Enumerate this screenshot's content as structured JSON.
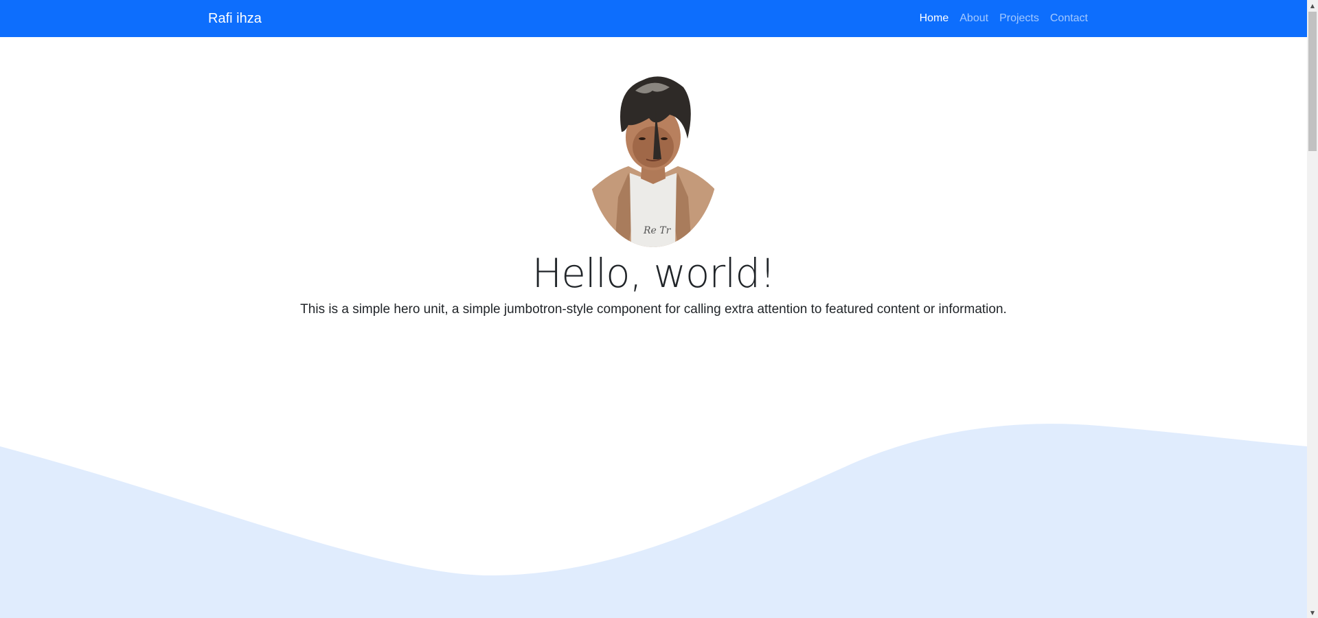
{
  "navbar": {
    "brand": "Rafi ihza",
    "links": [
      {
        "label": "Home",
        "active": true
      },
      {
        "label": "About",
        "active": false
      },
      {
        "label": "Projects",
        "active": false
      },
      {
        "label": "Contact",
        "active": false
      }
    ],
    "background_color": "#0d6efd"
  },
  "hero": {
    "avatar_icon": "profile-photo",
    "title": "Hello, world!",
    "lead": "This is a simple hero unit, a simple jumbotron-style component for calling extra attention to featured content or information."
  },
  "colors": {
    "wave": "#e0ecfd",
    "text": "#212529"
  },
  "scrollbar": {
    "up_icon": "scroll-up-arrow",
    "down_icon": "scroll-down-arrow"
  }
}
